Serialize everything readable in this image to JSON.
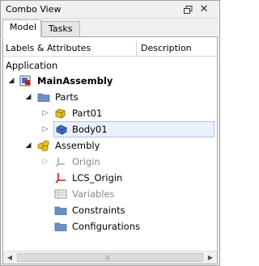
{
  "window": {
    "title": "Combo View",
    "float_icon": "float-icon",
    "close_icon": "close-icon",
    "close_glyph": "✕",
    "float_glyph": "🗗"
  },
  "tabs": [
    {
      "label": "Model",
      "active": true
    },
    {
      "label": "Tasks",
      "active": false
    }
  ],
  "tree_header": {
    "col1": "Labels & Attributes",
    "col2": "Description"
  },
  "tree": {
    "root_label": "Application",
    "items": [
      {
        "label": "MainAssembly",
        "icon": "assembly-document-icon",
        "expanded": true,
        "bold": true
      },
      {
        "label": "Parts",
        "icon": "folder-icon",
        "expanded": true
      },
      {
        "label": "Part01",
        "icon": "part-icon",
        "expanded": false
      },
      {
        "label": "Body01",
        "icon": "body-icon",
        "expanded": false,
        "selected": true
      },
      {
        "label": "Assembly",
        "icon": "assembly-icon",
        "expanded": true
      },
      {
        "label": "Origin",
        "icon": "origin-icon",
        "expanded": false,
        "disabled": true
      },
      {
        "label": "LCS_Origin",
        "icon": "lcs-icon"
      },
      {
        "label": "Variables",
        "icon": "variables-icon",
        "disabled": true
      },
      {
        "label": "Constraints",
        "icon": "folder-icon"
      },
      {
        "label": "Configurations",
        "icon": "folder-icon"
      }
    ]
  },
  "colors": {
    "selection_bg": "#eaf1fb",
    "selection_border": "#7a99c6",
    "folder": "#6a8fc9",
    "part_yellow": "#e8c020",
    "body_blue": "#3f6fc8",
    "lcs_red": "#c02020"
  },
  "scrollbar": {
    "left_icon": "scroll-left-icon",
    "right_icon": "scroll-right-icon",
    "grip": "|||"
  }
}
